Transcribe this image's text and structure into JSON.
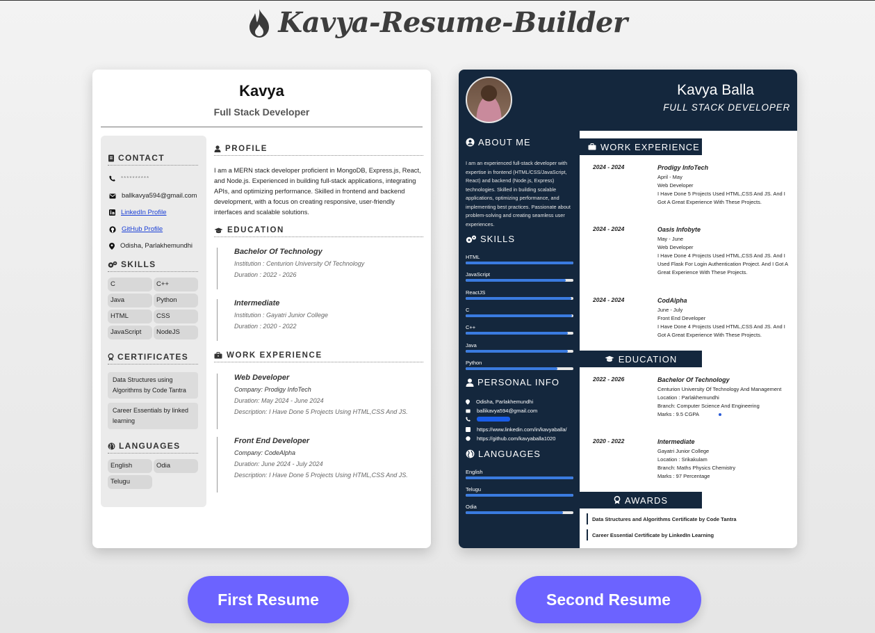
{
  "app": {
    "title": "Kavya-Resume-Builder",
    "logo_icon": "fire-icon",
    "accent_color": "#6c63ff"
  },
  "resume1": {
    "name": "Kavya",
    "role": "Full Stack Developer",
    "contact": {
      "heading": "CONTACT",
      "phone": "**********",
      "email": "ballkavya594@gmail.com",
      "linkedin": "LinkedIn Profile",
      "github": "GitHub Profile",
      "location": "Odisha, Parlakhemundhi"
    },
    "skills": {
      "heading": "SKILLS",
      "items": [
        "C",
        "C++",
        "Java",
        "Python",
        "HTML",
        "CSS",
        "JavaScript",
        "NodeJS"
      ]
    },
    "certificates": {
      "heading": "CERTIFICATES",
      "items": [
        "Data Structures using Algorithms by Code Tantra",
        "Career Essentials by linked learning"
      ]
    },
    "languages": {
      "heading": "LANGUAGES",
      "items": [
        "English",
        "Odia",
        "Telugu"
      ]
    },
    "profile": {
      "heading": "PROFILE",
      "text": "I am a MERN stack developer proficient in MongoDB, Express.js, React, and Node.js. Experienced in building full-stack applications, integrating APIs, and optimizing performance. Skilled in frontend and backend development, with a focus on creating responsive, user-friendly interfaces and scalable solutions."
    },
    "education": {
      "heading": "EDUCATION",
      "items": [
        {
          "title": "Bachelor Of Technology",
          "institution": "Institution : Centurion University Of Technology",
          "duration": "Duration : 2022 - 2026"
        },
        {
          "title": "Intermediate",
          "institution": "Institution : Gayatri Junior College",
          "duration": "Duration : 2020 - 2022"
        }
      ]
    },
    "work": {
      "heading": "WORK EXPERIENCE",
      "items": [
        {
          "title": "Web Developer",
          "company": "Company: Prodigy InfoTech",
          "duration": "Duration: May 2024 - June 2024",
          "description": "Description: I Have Done 5 Projects Using HTML,CSS And JS."
        },
        {
          "title": "Front End Developer",
          "company": "Company: CodeAlpha",
          "duration": "Duration: June 2024 - July 2024",
          "description": "Description: I Have Done 5 Projects Using HTML,CSS And JS."
        }
      ]
    }
  },
  "resume2": {
    "name": "Kavya Balla",
    "role": "FULL STACK DEVELOPER",
    "theme_color": "#14273d",
    "about": {
      "heading": "ABOUT ME",
      "text": "I am an experienced full-stack developer with expertise in frontend (HTML/CSS/JavaScript, React) and backend (Node.js, Express) technologies. Skilled in building scalable applications, optimizing performance, and implementing best practices. Passionate about problem-solving and creating seamless user experiences."
    },
    "skills": {
      "heading": "SKILLS",
      "items": [
        {
          "name": "HTML",
          "level": 100
        },
        {
          "name": "JavaScript",
          "level": 93
        },
        {
          "name": "ReactJS",
          "level": 98
        },
        {
          "name": "C",
          "level": 99
        },
        {
          "name": "C++",
          "level": 95
        },
        {
          "name": "Java",
          "level": 95
        },
        {
          "name": "Python",
          "level": 85
        }
      ]
    },
    "personal_info": {
      "heading": "PERSONAL INFO",
      "location": "Odisha, Parlakhemundhi",
      "email": "ballikavya594@gmail.com",
      "linkedin": "https://www.linkedin.com/in/kavyaballa/",
      "github": "https://github.com/kavyaballa1020"
    },
    "languages": {
      "heading": "LANGUAGES",
      "items": [
        {
          "name": "English",
          "level": 100
        },
        {
          "name": "Telugu",
          "level": 100
        },
        {
          "name": "Odia",
          "level": 90
        }
      ]
    },
    "work": {
      "heading": "WORK EXPERIENCE",
      "items": [
        {
          "date": "2024 - 2024",
          "title": "Prodigy InfoTech",
          "period": "April - May",
          "role": "Web Developer",
          "description": "I Have Done 5 Projects Used HTML,CSS And JS. And I Got A Great Experience With These Projects."
        },
        {
          "date": "2024 - 2024",
          "title": "Oasis Infobyte",
          "period": "May - June",
          "role": "Web Developer",
          "description": "I Have Done 4 Projects Used HTML,CSS And JS. And I Used Flask For Login Authentication Project. And I Got A Great Experience With These Projects."
        },
        {
          "date": "2024 - 2024",
          "title": "CodAlpha",
          "period": "June - July",
          "role": "Front End Developer",
          "description": "I Have Done 4 Projects Used HTML,CSS And JS. And I Got A Great Experience With These Projects."
        }
      ]
    },
    "education": {
      "heading": "EDUCATION",
      "items": [
        {
          "date": "2022 - 2026",
          "title": "Bachelor Of Technology",
          "lines": [
            "Centurion University Of Technology And Management",
            "Location : Parlakhemundhi",
            "Branch: Computer Science And Engineering",
            "Marks : 9.5 CGPA"
          ]
        },
        {
          "date": "2020 - 2022",
          "title": "Intermediate",
          "lines": [
            "Gayatri Junior College",
            "Location : Srikakulam",
            "Branch: Maths Physics Chemistry",
            "Marks : 97 Percentage"
          ]
        }
      ]
    },
    "awards": {
      "heading": "AWARDS",
      "items": [
        "Data Structures and Algorithms Certificate by Code Tantra",
        "Career Essential Certificate by LinkedIn Learning"
      ]
    }
  },
  "buttons": {
    "first": "First Resume",
    "second": "Second Resume"
  }
}
